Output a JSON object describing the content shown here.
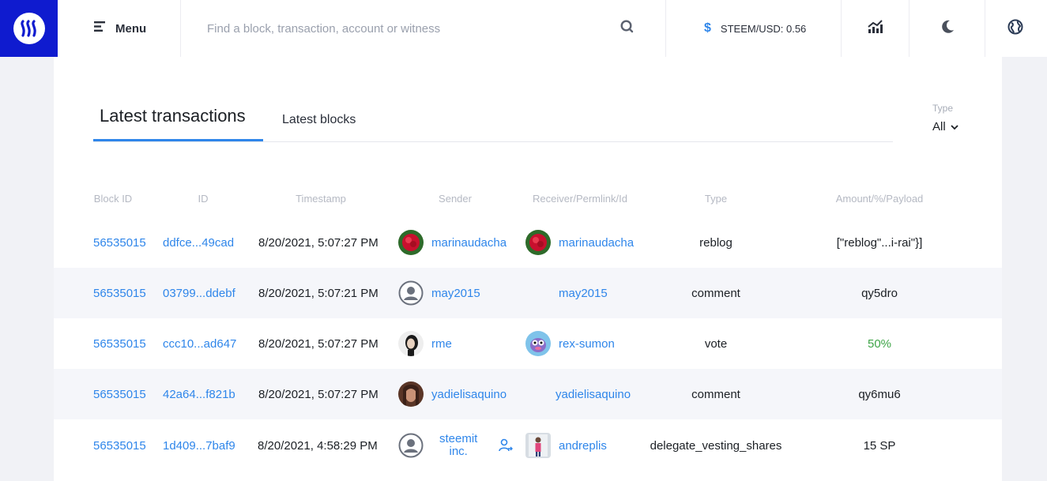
{
  "header": {
    "menu_label": "Menu",
    "search_placeholder": "Find a block, transaction, account or witness",
    "price_symbol": "$",
    "price_text": "STEEM/USD: 0.56"
  },
  "tabs": {
    "latest_transactions": "Latest transactions",
    "latest_blocks": "Latest blocks"
  },
  "type_filter": {
    "caption": "Type",
    "value": "All"
  },
  "table": {
    "columns": [
      "Block ID",
      "ID",
      "Timestamp",
      "Sender",
      "Receiver/Permlink/Id",
      "Type",
      "Amount/%/Payload"
    ],
    "rows": [
      {
        "block": "56535015",
        "id": "ddfce...49cad",
        "timestamp": "8/20/2021, 5:07:27 PM",
        "sender": "marinaudacha",
        "receiver": "marinaudacha",
        "type": "reblog",
        "amount": "[\"reblog\"...i-rai\"}]"
      },
      {
        "block": "56535015",
        "id": "03799...ddebf",
        "timestamp": "8/20/2021, 5:07:21 PM",
        "sender": "may2015",
        "receiver": "may2015",
        "type": "comment",
        "amount": "qy5dro"
      },
      {
        "block": "56535015",
        "id": "ccc10...ad647",
        "timestamp": "8/20/2021, 5:07:27 PM",
        "sender": "rme",
        "receiver": "rex-sumon",
        "type": "vote",
        "amount": "50%"
      },
      {
        "block": "56535015",
        "id": "42a64...f821b",
        "timestamp": "8/20/2021, 5:07:27 PM",
        "sender": "yadielisaquino",
        "receiver": "yadielisaquino",
        "type": "comment",
        "amount": "qy6mu6"
      },
      {
        "block": "56535015",
        "id": "1d409...7baf9",
        "timestamp": "8/20/2021, 4:58:29 PM",
        "sender_line1": "steemit",
        "sender_line2": "inc.",
        "receiver": "andreplis",
        "type": "delegate_vesting_shares",
        "amount": "15 SP"
      }
    ]
  },
  "colors": {
    "brand": "#0f1bcf",
    "link": "#2f86ea",
    "positive": "#3da447",
    "row_alt": "#f5f6fa"
  }
}
